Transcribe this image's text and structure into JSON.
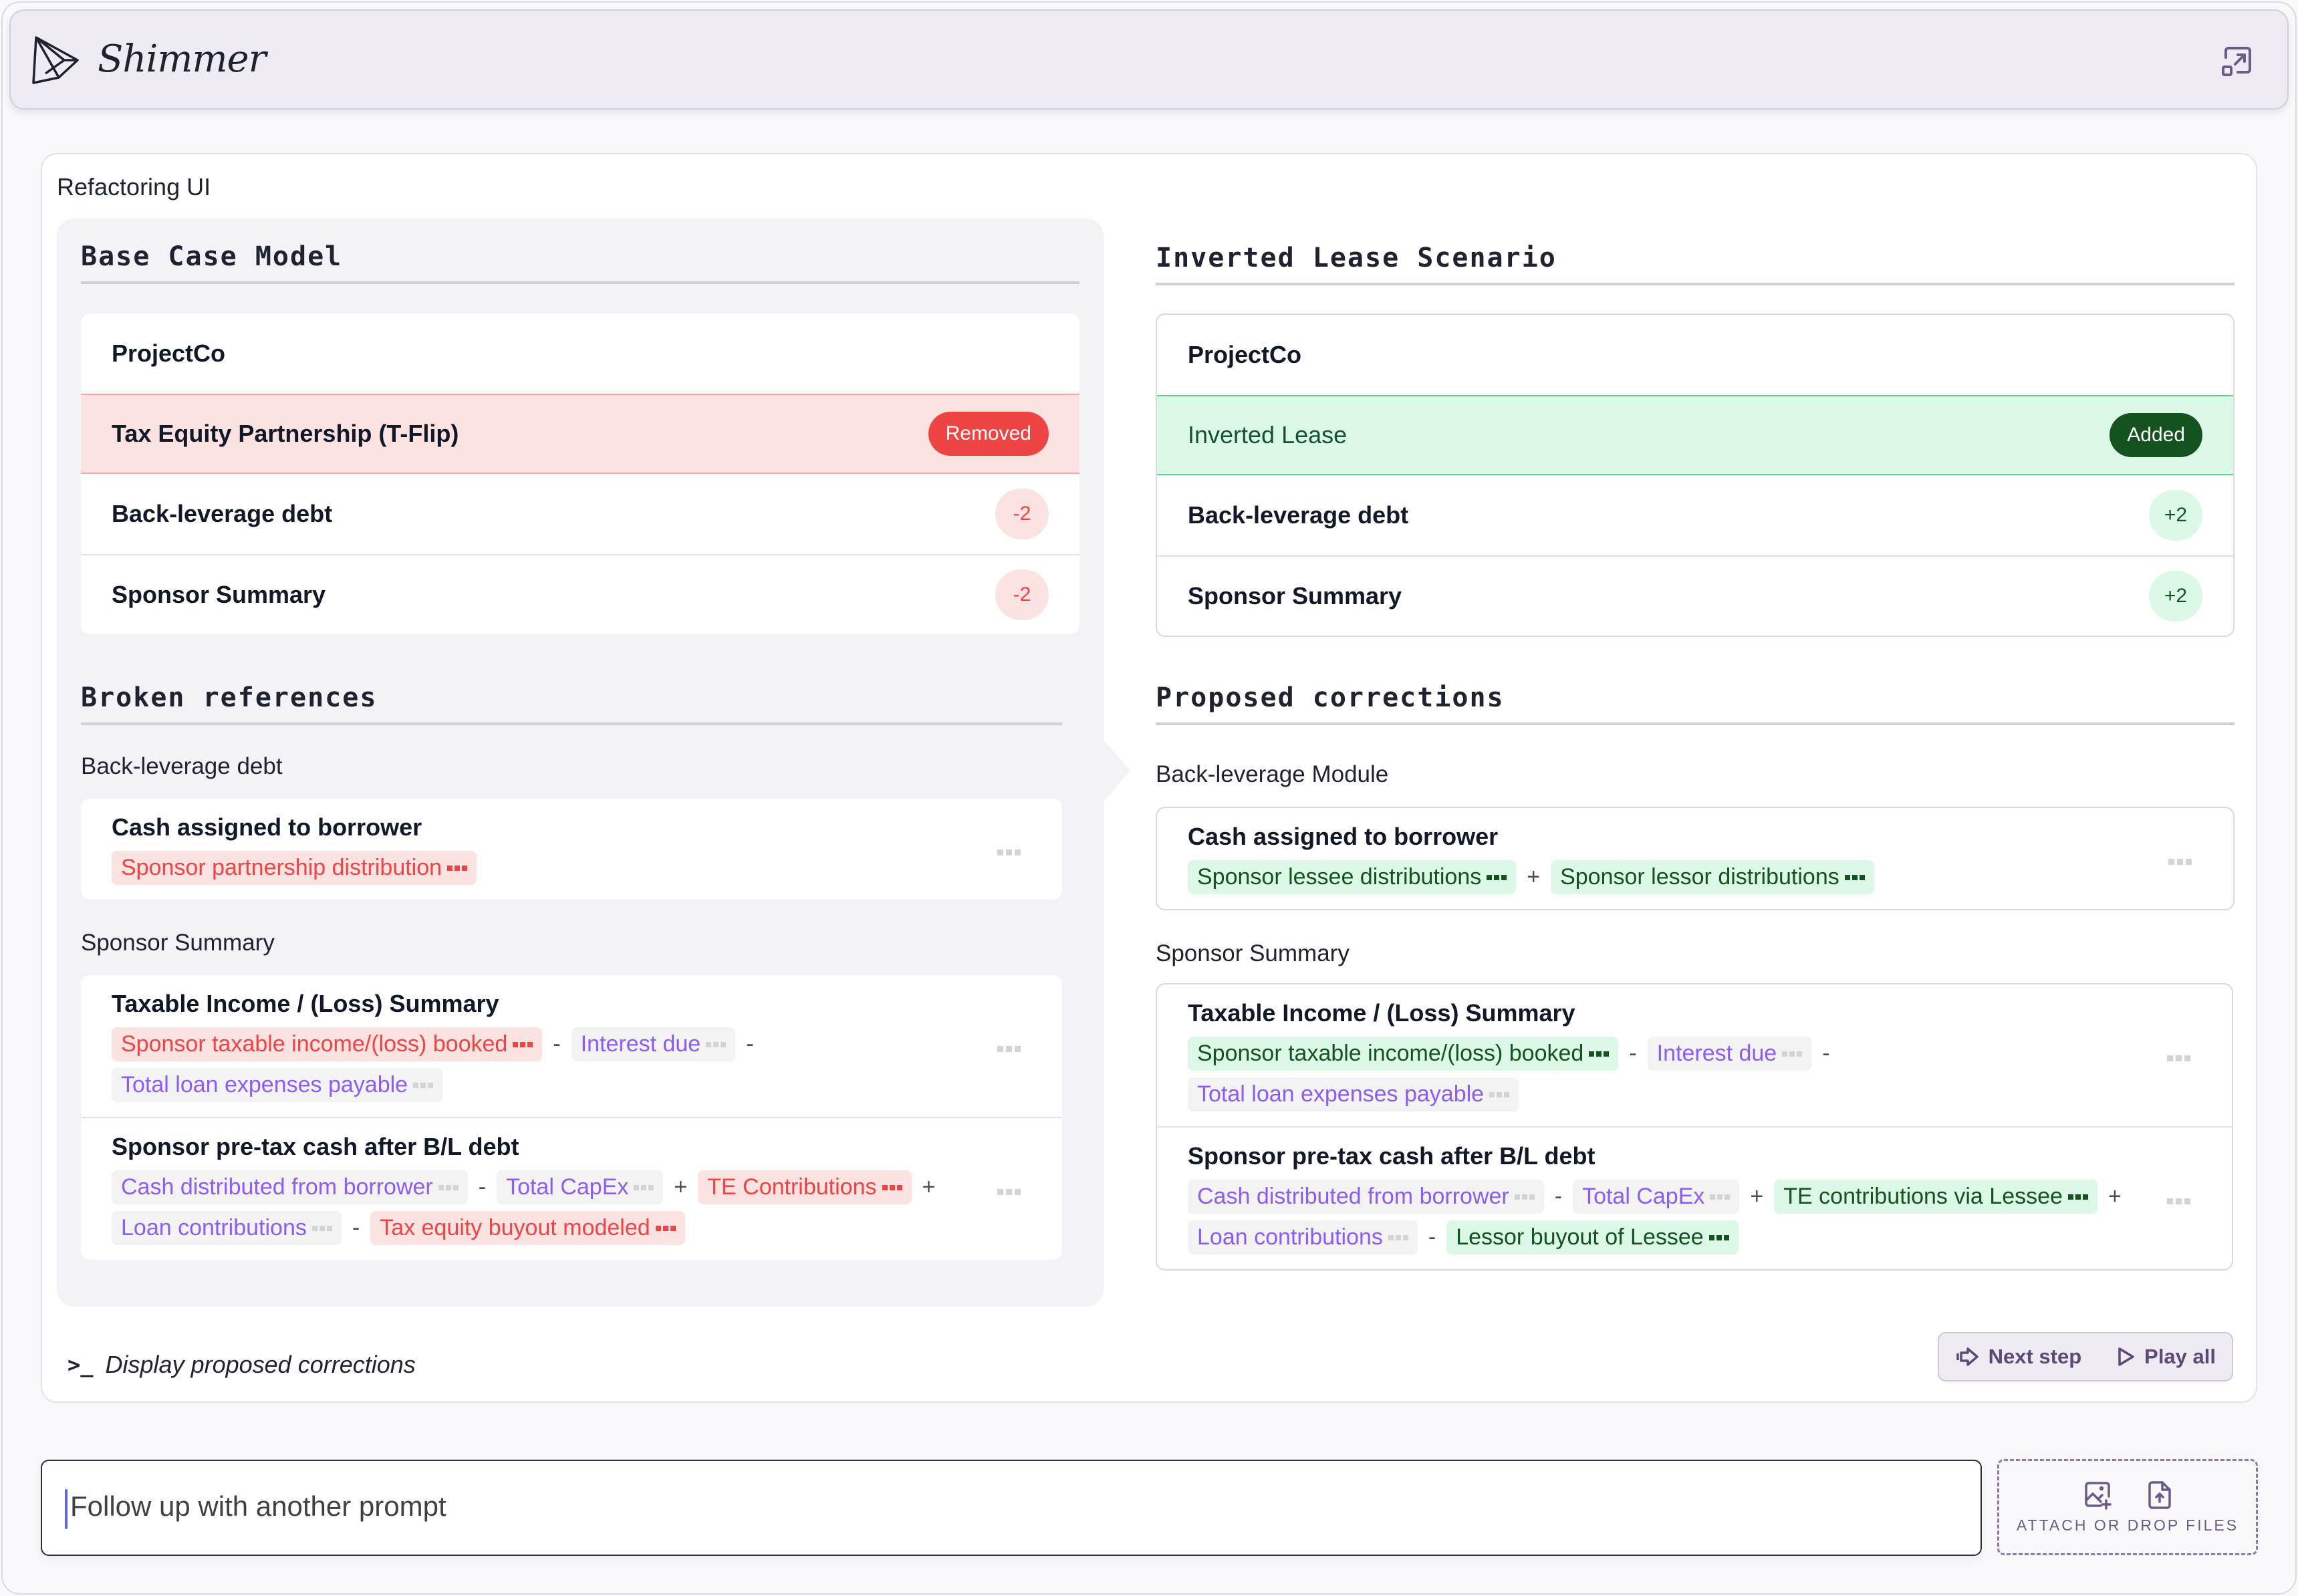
{
  "app": {
    "name": "Shimmer",
    "expand_icon": "expand-window-icon"
  },
  "card": {
    "title": "Refactoring UI"
  },
  "base_case": {
    "heading": "Base Case Model",
    "rows": [
      {
        "label": "ProjectCo",
        "badge": null
      },
      {
        "label": "Tax Equity Partnership (T-Flip)",
        "badge": "Removed",
        "status": "removed"
      },
      {
        "label": "Back-leverage debt",
        "badge": "-2",
        "status": "count"
      },
      {
        "label": "Sponsor Summary",
        "badge": "-2",
        "status": "count"
      }
    ]
  },
  "inverted": {
    "heading": "Inverted Lease Scenario",
    "rows": [
      {
        "label": "ProjectCo",
        "badge": null
      },
      {
        "label": "Inverted Lease",
        "badge": "Added",
        "status": "added"
      },
      {
        "label": "Back-leverage debt",
        "badge": "+2",
        "status": "count"
      },
      {
        "label": "Sponsor Summary",
        "badge": "+2",
        "status": "count"
      }
    ]
  },
  "broken": {
    "heading": "Broken references",
    "groups": [
      {
        "label": "Back-leverage debt",
        "items": [
          {
            "title": "Cash assigned to borrower",
            "formula": [
              {
                "t": "tok",
                "kind": "broken",
                "text": "Sponsor partnership distribution"
              }
            ]
          }
        ]
      },
      {
        "label": "Sponsor Summary",
        "items": [
          {
            "title": "Taxable Income / (Loss) Summary",
            "formula": [
              {
                "t": "tok",
                "kind": "broken",
                "text": "Sponsor taxable income/(loss) booked"
              },
              {
                "t": "op",
                "text": "-"
              },
              {
                "t": "tok",
                "kind": "neutral",
                "text": "Interest due"
              },
              {
                "t": "op",
                "text": "-"
              },
              {
                "t": "tok",
                "kind": "neutral",
                "text": "Total loan expenses payable"
              }
            ]
          },
          {
            "title": "Sponsor pre-tax cash after B/L debt",
            "formula": [
              {
                "t": "tok",
                "kind": "neutral",
                "text": "Cash distributed from borrower"
              },
              {
                "t": "op",
                "text": "-"
              },
              {
                "t": "tok",
                "kind": "neutral",
                "text": "Total CapEx"
              },
              {
                "t": "op",
                "text": "+"
              },
              {
                "t": "tok",
                "kind": "broken",
                "text": "TE Contributions"
              },
              {
                "t": "op",
                "text": "+"
              },
              {
                "t": "tok",
                "kind": "neutral",
                "text": "Loan contributions"
              },
              {
                "t": "op",
                "text": "-"
              },
              {
                "t": "tok",
                "kind": "broken",
                "text": "Tax equity buyout modeled"
              }
            ]
          }
        ]
      }
    ]
  },
  "proposed": {
    "heading": "Proposed corrections",
    "groups": [
      {
        "label": "Back-leverage Module",
        "items": [
          {
            "title": "Cash assigned to borrower",
            "formula": [
              {
                "t": "tok",
                "kind": "fixed",
                "text": "Sponsor lessee distributions"
              },
              {
                "t": "op",
                "text": "+"
              },
              {
                "t": "tok",
                "kind": "fixed",
                "text": "Sponsor lessor distributions"
              }
            ]
          }
        ]
      },
      {
        "label": "Sponsor Summary",
        "items": [
          {
            "title": "Taxable Income / (Loss) Summary",
            "formula": [
              {
                "t": "tok",
                "kind": "fixed",
                "text": "Sponsor taxable income/(loss) booked"
              },
              {
                "t": "op",
                "text": "-"
              },
              {
                "t": "tok",
                "kind": "neutral",
                "text": "Interest due"
              },
              {
                "t": "op",
                "text": "-"
              },
              {
                "t": "tok",
                "kind": "neutral",
                "text": "Total loan expenses payable"
              }
            ]
          },
          {
            "title": "Sponsor pre-tax cash after B/L debt",
            "formula": [
              {
                "t": "tok",
                "kind": "neutral",
                "text": "Cash distributed from borrower"
              },
              {
                "t": "op",
                "text": "-"
              },
              {
                "t": "tok",
                "kind": "neutral",
                "text": "Total CapEx"
              },
              {
                "t": "op",
                "text": "+"
              },
              {
                "t": "tok",
                "kind": "fixed",
                "text": "TE contributions via Lessee"
              },
              {
                "t": "op",
                "text": "+"
              },
              {
                "t": "tok",
                "kind": "neutral",
                "text": "Loan contributions"
              },
              {
                "t": "op",
                "text": "-"
              },
              {
                "t": "tok",
                "kind": "fixed",
                "text": "Lessor buyout of Lessee"
              }
            ]
          }
        ]
      }
    ]
  },
  "footer": {
    "command_label": "Display proposed corrections",
    "next_step": "Next step",
    "play_all": "Play all"
  },
  "prompt": {
    "placeholder": "Follow up with another prompt"
  },
  "attach": {
    "label": "ATTACH OR DROP FILES"
  },
  "colors": {
    "removed": "#ef4444",
    "removed_bg": "#fde2e2",
    "added": "#14531f",
    "added_bg": "#dcf8e6",
    "reference": "#8b5cf6",
    "brand": "#5b4a78"
  }
}
